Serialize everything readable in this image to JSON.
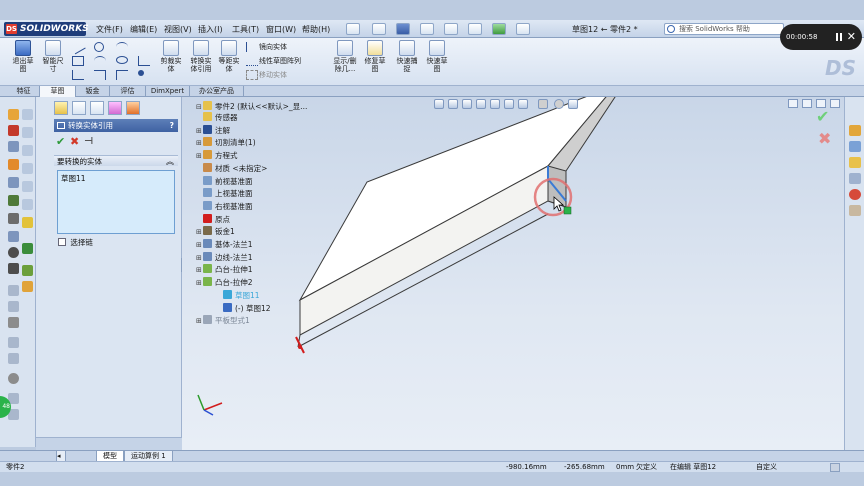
{
  "app": {
    "logo_text": "SOLIDWORKS",
    "doc_title": "草图12 ← 零件2 *",
    "menus": [
      "文件(F)",
      "编辑(E)",
      "视图(V)",
      "插入(I)",
      "工具(T)",
      "窗口(W)",
      "帮助(H)"
    ],
    "help_search_placeholder": "搜索 SolidWorks 帮助",
    "video_time": "00:00:58"
  },
  "command_manager": {
    "exit_sketch": "退出草图",
    "smart_dimension": "智能尺寸",
    "trim": "剪裁实体",
    "convert": "转换实体引用",
    "offset": "等距实体",
    "mirror": "镜向实体",
    "linear_pattern": "线性草图阵列",
    "move": "移动实体",
    "display_delete": "显示/删除几...",
    "repair": "修复草图",
    "quick_snaps": "快速捕捉",
    "rapid_sketch": "快速草图"
  },
  "tabs": [
    "特征",
    "草图",
    "钣金",
    "评估",
    "DimXpert",
    "办公室产品"
  ],
  "active_tab": 1,
  "property_manager": {
    "title": "转换实体引用",
    "help": "?",
    "group_title": "要转换的实体",
    "selected_items": [
      "草图11"
    ],
    "checkbox_label": "选择链",
    "green_badge": "48"
  },
  "feature_tree": {
    "root": "零件2 (默认<<默认>_显...",
    "items": [
      {
        "label": "传感器",
        "expandable": false,
        "style": "normal"
      },
      {
        "label": "注解",
        "expandable": true,
        "style": "normal"
      },
      {
        "label": "切割清单(1)",
        "expandable": true,
        "style": "normal"
      },
      {
        "label": "方程式",
        "expandable": true,
        "style": "normal"
      },
      {
        "label": "材质 <未指定>",
        "expandable": false,
        "style": "normal"
      },
      {
        "label": "前视基准面",
        "expandable": false,
        "style": "normal"
      },
      {
        "label": "上视基准面",
        "expandable": false,
        "style": "normal"
      },
      {
        "label": "右视基准面",
        "expandable": false,
        "style": "normal"
      },
      {
        "label": "原点",
        "expandable": false,
        "style": "normal"
      },
      {
        "label": "钣金1",
        "expandable": true,
        "style": "normal"
      },
      {
        "label": "基体-法兰1",
        "expandable": true,
        "style": "normal"
      },
      {
        "label": "边线-法兰1",
        "expandable": true,
        "style": "normal"
      },
      {
        "label": "凸台-拉伸1",
        "expandable": true,
        "style": "normal"
      },
      {
        "label": "凸台-拉伸2",
        "expandable": true,
        "style": "normal"
      },
      {
        "label": "草图11",
        "expandable": false,
        "style": "highlight"
      },
      {
        "label": "(-) 草图12",
        "expandable": false,
        "style": "normal"
      },
      {
        "label": "平板型式1",
        "expandable": true,
        "style": "dim"
      }
    ]
  },
  "model_tabs": [
    "模型",
    "运动算例 1"
  ],
  "status": {
    "doc": "零件2",
    "x": "-980.16mm",
    "y": "-265.68mm",
    "z": "0mm",
    "definition": "欠定义",
    "editing": "在编辑 草图12",
    "units": "自定义"
  }
}
